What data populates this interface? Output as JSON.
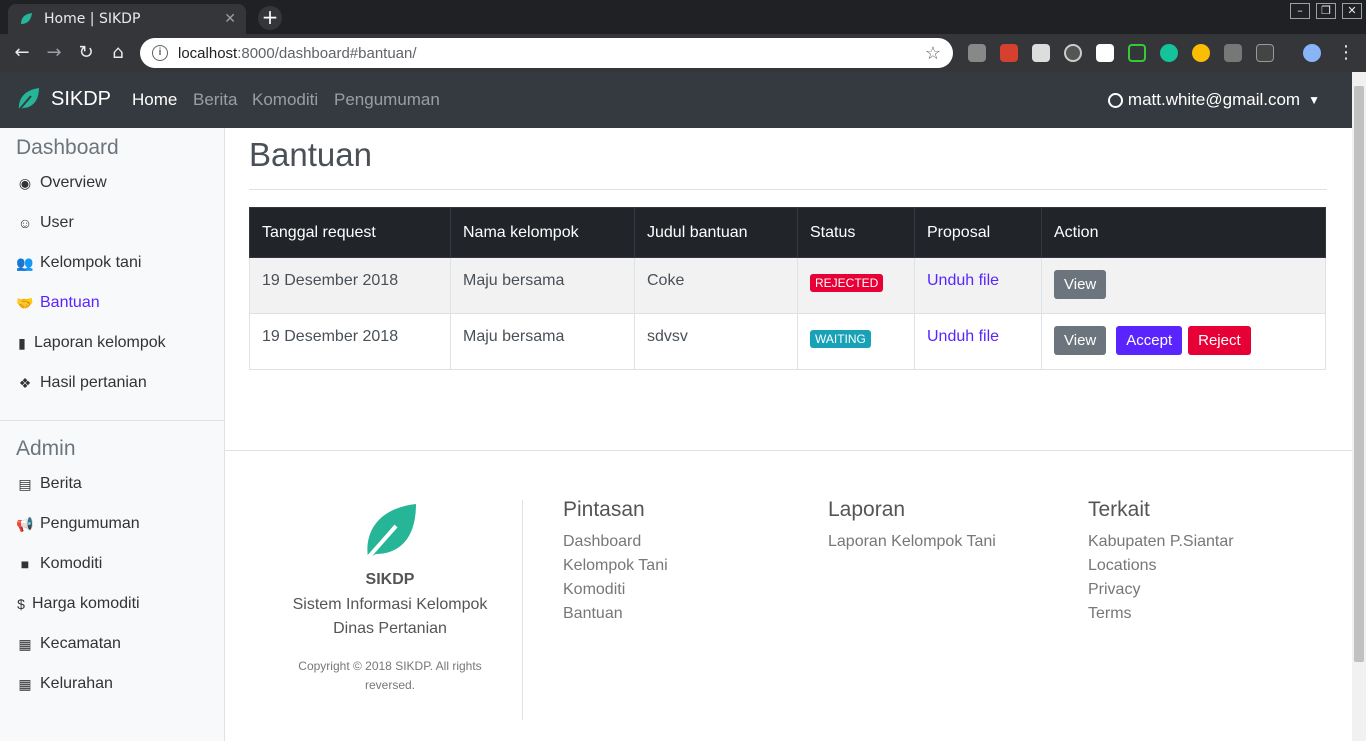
{
  "browser": {
    "tab_title": "Home | SIKDP",
    "url_host": "localhost",
    "url_path": ":8000/dashboard#bantuan/"
  },
  "navbar": {
    "brand": "SIKDP",
    "links": [
      "Home",
      "Berita",
      "Komoditi",
      "Pengumuman"
    ],
    "user": "matt.white@gmail.com"
  },
  "sidebar": {
    "dashboard_heading": "Dashboard",
    "dashboard_items": [
      {
        "label": "Overview",
        "icon": "dot-circle-icon"
      },
      {
        "label": "User",
        "icon": "user-circle-icon"
      },
      {
        "label": "Kelompok tani",
        "icon": "users-icon"
      },
      {
        "label": "Bantuan",
        "icon": "handshake-icon"
      },
      {
        "label": "Laporan kelompok",
        "icon": "file-icon"
      },
      {
        "label": "Hasil pertanian",
        "icon": "cubes-icon"
      }
    ],
    "admin_heading": "Admin",
    "admin_items": [
      {
        "label": "Berita",
        "icon": "newspaper-icon"
      },
      {
        "label": "Pengumuman",
        "icon": "bullhorn-icon"
      },
      {
        "label": "Komoditi",
        "icon": "box-icon"
      },
      {
        "label": "Harga komoditi",
        "icon": "dollar-icon"
      },
      {
        "label": "Kecamatan",
        "icon": "building-icon"
      },
      {
        "label": "Kelurahan",
        "icon": "building-icon"
      }
    ]
  },
  "main": {
    "title": "Bantuan",
    "columns": [
      "Tanggal request",
      "Nama kelompok",
      "Judul bantuan",
      "Status",
      "Proposal",
      "Action"
    ],
    "rows": [
      {
        "date": "19 Desember 2018",
        "group": "Maju bersama",
        "title": "Coke",
        "status": "REJECTED",
        "proposal": "Unduh file",
        "view": "View"
      },
      {
        "date": "19 Desember 2018",
        "group": "Maju bersama",
        "title": "sdvsv",
        "status": "WAITING",
        "proposal": "Unduh file",
        "view": "View",
        "accept": "Accept",
        "reject": "Reject"
      }
    ]
  },
  "footer": {
    "brand": "SIKDP",
    "desc_line1": "Sistem Informasi Kelompok",
    "desc_line2": "Dinas Pertanian",
    "copyright_line1": "Copyright © 2018 SIKDP. All rights",
    "copyright_line2": "reversed.",
    "pintasan": {
      "heading": "Pintasan",
      "links": [
        "Dashboard",
        "Kelompok Tani",
        "Komoditi",
        "Bantuan"
      ]
    },
    "laporan": {
      "heading": "Laporan",
      "links": [
        "Laporan Kelompok Tani"
      ]
    },
    "terkait": {
      "heading": "Terkait",
      "links": [
        "Kabupaten P.Siantar",
        "Locations",
        "Privacy",
        "Terms"
      ]
    }
  },
  "colors": {
    "accent": "#5a24ff",
    "rejected": "#e60035",
    "waiting": "#17a2b8",
    "brand_leaf": "#26b597",
    "navbar": "#343a40"
  }
}
